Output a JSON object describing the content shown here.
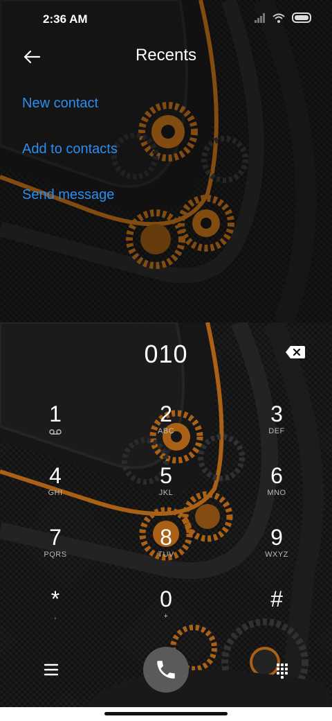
{
  "status_bar": {
    "time": "2:36 AM"
  },
  "header": {
    "title": "Recents"
  },
  "actions": [
    {
      "label": "New contact"
    },
    {
      "label": "Add to contacts"
    },
    {
      "label": "Send message"
    }
  ],
  "dialer": {
    "number": "010"
  },
  "keypad": [
    {
      "digit": "1",
      "letters": ""
    },
    {
      "digit": "2",
      "letters": "ABC"
    },
    {
      "digit": "3",
      "letters": "DEF"
    },
    {
      "digit": "4",
      "letters": "GHI"
    },
    {
      "digit": "5",
      "letters": "JKL"
    },
    {
      "digit": "6",
      "letters": "MNO"
    },
    {
      "digit": "7",
      "letters": "PQRS"
    },
    {
      "digit": "8",
      "letters": "TUV"
    },
    {
      "digit": "9",
      "letters": "WXYZ"
    },
    {
      "digit": "*",
      "letters": ","
    },
    {
      "digit": "0",
      "letters": "+"
    },
    {
      "digit": "#",
      "letters": ""
    }
  ],
  "colors": {
    "accent": "#2a8ef0",
    "call_button": "#5a5a5a",
    "gear_orange": "#c8731a"
  },
  "icons": {
    "back": "arrow-left-icon",
    "backspace": "backspace-icon",
    "menu": "menu-icon",
    "call": "phone-icon",
    "dialpad": "dialpad-icon",
    "voicemail": "voicemail-icon"
  }
}
